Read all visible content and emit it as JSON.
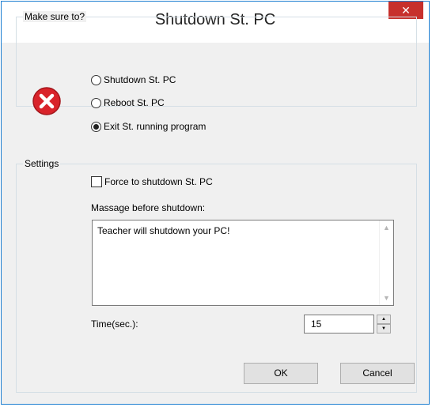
{
  "window": {
    "title": "Shutdown St. PC",
    "close_label": "✕"
  },
  "make_sure": {
    "legend": "Make sure to?",
    "options": [
      {
        "label": "Shutdown St. PC",
        "checked": false
      },
      {
        "label": "Reboot St. PC",
        "checked": false
      },
      {
        "label": "Exit St. running program",
        "checked": true
      }
    ]
  },
  "settings": {
    "legend": "Settings",
    "force_label": "Force to shutdown St. PC",
    "force_checked": false,
    "message_label": "Massage before shutdown:",
    "message_value": "Teacher will shutdown your PC!",
    "time_label": "Time(sec.):",
    "time_value": "15"
  },
  "buttons": {
    "ok": "OK",
    "cancel": "Cancel"
  },
  "colors": {
    "error_red": "#d9232a",
    "close_red": "#c7302c",
    "border_blue": "#1e7fd1"
  }
}
